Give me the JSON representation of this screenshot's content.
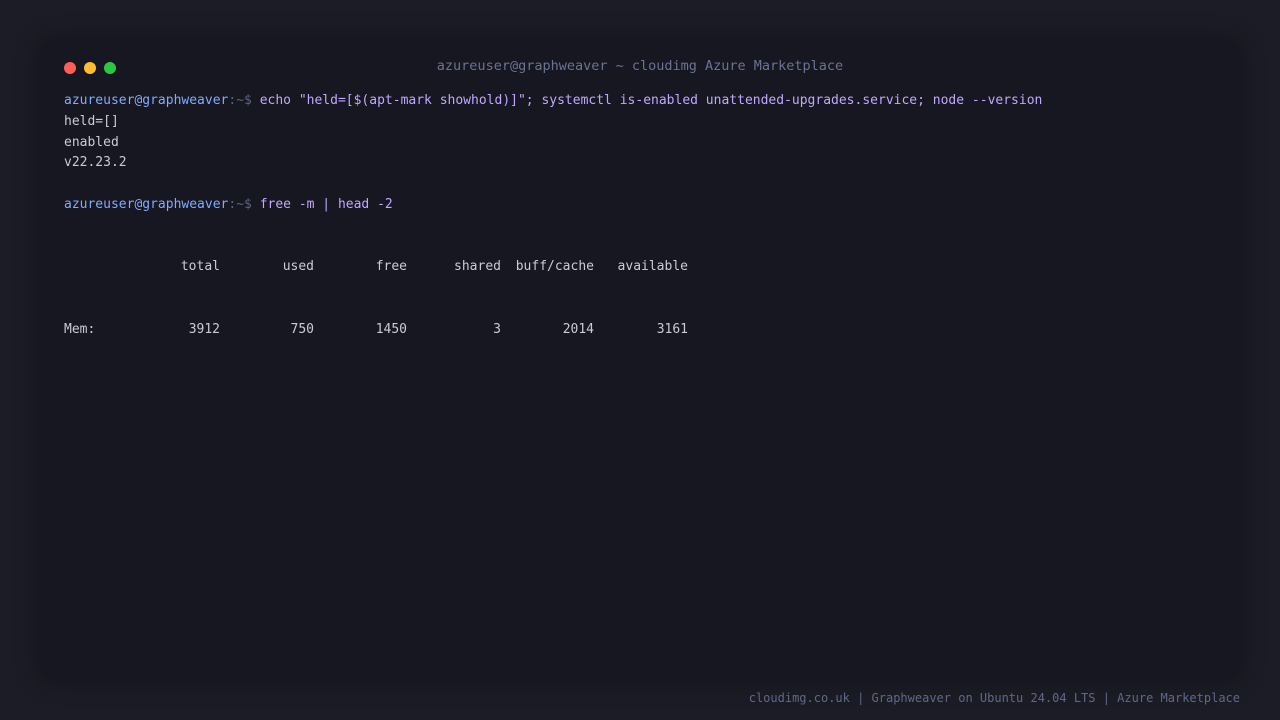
{
  "window": {
    "title": "azureuser@graphweaver ~ cloudimg Azure Marketplace"
  },
  "prompt": {
    "user": "azureuser@graphweaver",
    "path": ":~$"
  },
  "session": {
    "cmd1": "echo \"held=[$(apt-mark showhold)]\"; systemctl is-enabled unattended-upgrades.service; node --version",
    "out1": [
      "held=[]",
      "enabled",
      "v22.23.2"
    ],
    "cmd2": "free -m | head -2",
    "mem_headers": [
      "total",
      "used",
      "free",
      "shared",
      "buff/cache",
      "available"
    ],
    "mem_row": {
      "label": "Mem:",
      "values": [
        "3912",
        "750",
        "1450",
        "3",
        "2014",
        "3161"
      ]
    }
  },
  "footer": {
    "text": "cloudimg.co.uk | Graphweaver on Ubuntu 24.04 LTS | Azure Marketplace"
  },
  "colors": {
    "background": "#1b1c25",
    "window": "#161720",
    "prompt_user": "#82aaff",
    "command": "#c3a6ff",
    "output": "#c9cbd6",
    "close": "#ff5f57",
    "minimize": "#febc2e",
    "maximize": "#28c840"
  }
}
